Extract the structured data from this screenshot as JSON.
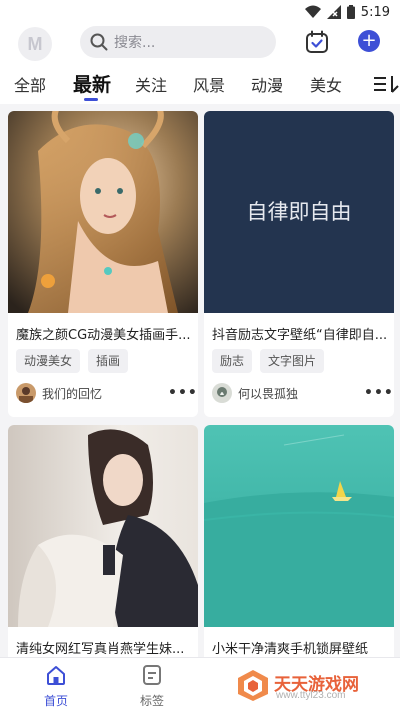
{
  "status_bar": {
    "time": "5:19",
    "icons": [
      "wifi-icon",
      "signal-icon",
      "battery-icon"
    ]
  },
  "header": {
    "logo_text": "M",
    "search_placeholder": "搜索...",
    "checkin_icon": "calendar-check-icon",
    "add_icon": "plus-icon",
    "add_symbol": "+"
  },
  "tabs": {
    "items": [
      "全部",
      "最新",
      "关注",
      "风景",
      "动漫",
      "美女"
    ],
    "active_index": 1,
    "more_icon": "menu-more-icon"
  },
  "cards": [
    {
      "title": "魔族之颜CG动漫美女插画手...",
      "tags": [
        "动漫美女",
        "插画"
      ],
      "author": "我们的回忆"
    },
    {
      "title": "抖音励志文字壁纸“自律即自...",
      "image_text": "自律即自由",
      "tags": [
        "励志",
        "文字图片"
      ],
      "author": "何以畏孤独"
    },
    {
      "title": "清纯女网红写真肖燕学生妹...",
      "tags": [],
      "author": ""
    },
    {
      "title": "小米干净清爽手机锁屏壁纸",
      "tags": [],
      "author": ""
    }
  ],
  "bottom_nav": {
    "items": [
      {
        "label": "首页",
        "icon": "home-icon",
        "active": true
      },
      {
        "label": "标签",
        "icon": "tag-list-icon",
        "active": false
      }
    ]
  },
  "watermark": {
    "main": "天天游戏网",
    "sub": "www.ttyl23.com"
  },
  "colors": {
    "accent": "#3d4fd6",
    "background": "#f4f4f6",
    "watermark": "#e8623a"
  }
}
